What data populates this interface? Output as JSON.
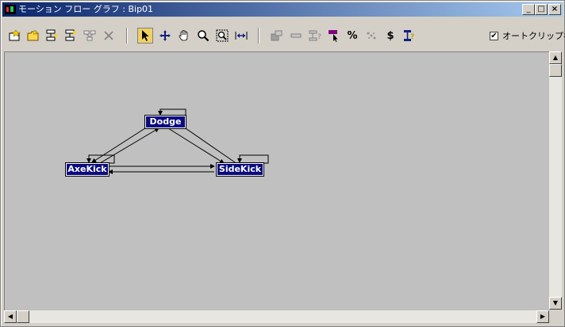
{
  "window": {
    "title": "モーション フロー グラフ : Bip01",
    "minimize_label": "_",
    "maximize_label": "□",
    "close_label": "×"
  },
  "toolbar": {
    "auto_clip_name_label": "オートクリップ名",
    "auto_clip_name_checked": true,
    "checked_glyph": "✔",
    "percent_label": "%",
    "dollar_label": "$"
  },
  "graph": {
    "nodes": [
      {
        "label": "Dodge"
      },
      {
        "label": "AxeKick"
      },
      {
        "label": "SideKick"
      }
    ]
  },
  "scrollbar": {
    "up": "▲",
    "down": "▼",
    "left": "◀",
    "right": "▶"
  },
  "colors": {
    "title_bar_start": "#0a246a",
    "title_bar_end": "#a6caf0",
    "node_fill": "#0a0a80",
    "canvas_bg": "#c0c0c0"
  }
}
